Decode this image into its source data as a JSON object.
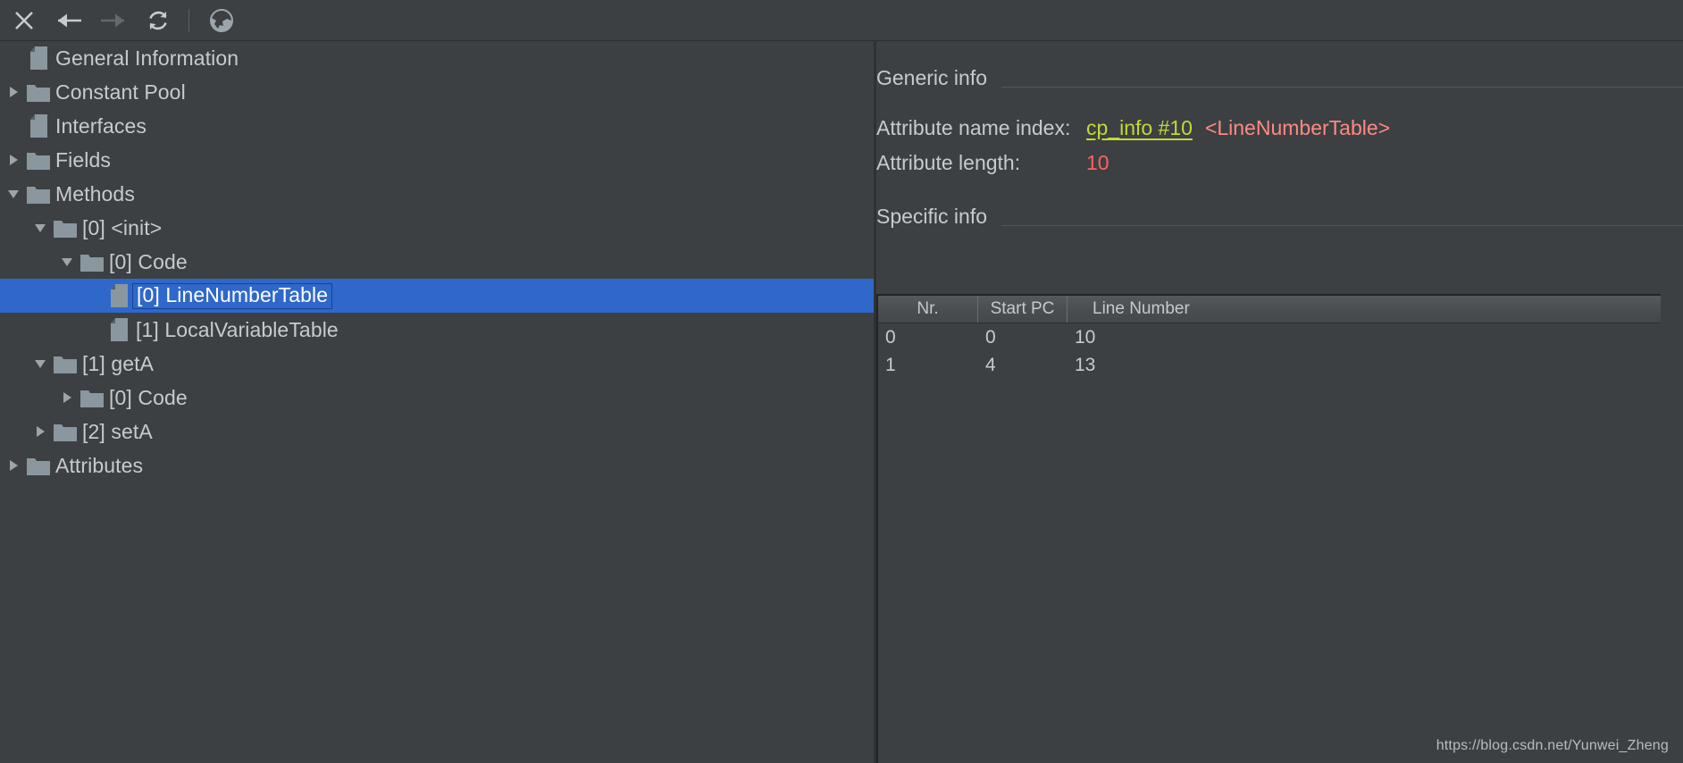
{
  "toolbar": {
    "buttons": [
      {
        "name": "close-icon",
        "label": "Close"
      },
      {
        "name": "back-arrow-icon",
        "label": "Back"
      },
      {
        "name": "forward-arrow-icon",
        "label": "Forward"
      },
      {
        "name": "reload-icon",
        "label": "Reload"
      }
    ],
    "globe_label": "Browse"
  },
  "tree": {
    "items": [
      {
        "label": "General Information",
        "depth": 0,
        "icon": "document",
        "twisty": "none",
        "selected": false
      },
      {
        "label": "Constant Pool",
        "depth": 0,
        "icon": "folder",
        "twisty": "closed",
        "selected": false
      },
      {
        "label": "Interfaces",
        "depth": 0,
        "icon": "document",
        "twisty": "none",
        "selected": false
      },
      {
        "label": "Fields",
        "depth": 0,
        "icon": "folder",
        "twisty": "closed",
        "selected": false
      },
      {
        "label": "Methods",
        "depth": 0,
        "icon": "folder",
        "twisty": "open",
        "selected": false
      },
      {
        "label": "[0] <init>",
        "depth": 1,
        "icon": "folder",
        "twisty": "open",
        "selected": false
      },
      {
        "label": "[0] Code",
        "depth": 2,
        "icon": "folder",
        "twisty": "open",
        "selected": false
      },
      {
        "label": "[0] LineNumberTable",
        "depth": 3,
        "icon": "document",
        "twisty": "none",
        "selected": true
      },
      {
        "label": "[1] LocalVariableTable",
        "depth": 3,
        "icon": "document",
        "twisty": "none",
        "selected": false
      },
      {
        "label": "[1] getA",
        "depth": 1,
        "icon": "folder",
        "twisty": "open",
        "selected": false
      },
      {
        "label": "[0] Code",
        "depth": 2,
        "icon": "folder",
        "twisty": "closed",
        "selected": false
      },
      {
        "label": "[2] setA",
        "depth": 1,
        "icon": "folder",
        "twisty": "closed",
        "selected": false
      },
      {
        "label": "Attributes",
        "depth": 0,
        "icon": "folder",
        "twisty": "closed",
        "selected": false
      }
    ]
  },
  "detail": {
    "generic_heading": "Generic info",
    "specific_heading": "Specific info",
    "attribute_name_index_label": "Attribute name index:",
    "attribute_name_index_link": "cp_info #10",
    "attribute_name_index_tag": "<LineNumberTable>",
    "attribute_length_label": "Attribute length:",
    "attribute_length_value": "10"
  },
  "table": {
    "columns": [
      "Nr.",
      "Start PC",
      "Line Number"
    ],
    "rows": [
      [
        "0",
        "0",
        "10"
      ],
      [
        "1",
        "4",
        "13"
      ]
    ]
  },
  "watermark": "https://blog.csdn.net/Yunwei_Zheng",
  "colors": {
    "background": "#3c4043",
    "selection": "#2f68ca",
    "link": "#c3d83a",
    "value_red": "#ff6161",
    "tag_red": "#ff8a80",
    "text": "#c8cbcd"
  }
}
